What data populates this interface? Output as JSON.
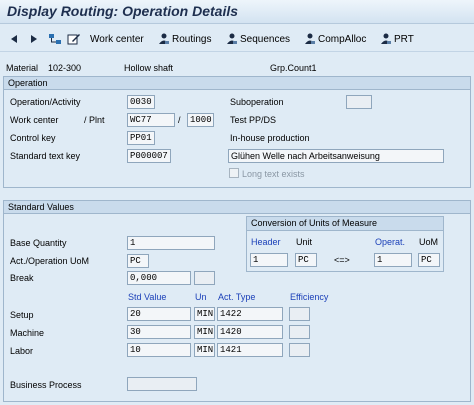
{
  "window": {
    "title": "Display Routing: Operation Details"
  },
  "toolbar": {
    "work_center": "Work center",
    "routings": "Routings",
    "sequences": "Sequences",
    "compalloc": "CompAlloc",
    "prt": "PRT"
  },
  "header": {
    "material_label": "Material",
    "material_value": "102-300",
    "material_desc": "Hollow shaft",
    "grp_count": "Grp.Count1"
  },
  "operation": {
    "group_title": "Operation",
    "op_activity_label": "Operation/Activity",
    "op_activity_value": "0030",
    "suboperation_label": "Suboperation",
    "suboperation_value": "",
    "work_center_label": "Work center",
    "plnt_label": "/ Plnt",
    "work_center_value": "WC77",
    "plant_value": "1000",
    "test_pp": "Test PP/DS",
    "control_key_label": "Control key",
    "control_key_value": "PP01",
    "inhouse": "In-house production",
    "std_text_label": "Standard text key",
    "std_text_value": "P000007",
    "std_text_desc": "Glühen Welle nach Arbeitsanweisung",
    "long_text": "Long text exists"
  },
  "standard_values": {
    "group_title": "Standard Values",
    "base_qty_label": "Base Quantity",
    "base_qty_value": "1",
    "act_uom_label": "Act./Operation UoM",
    "act_uom_value": "PC",
    "break_label": "Break",
    "break_value": "0,000",
    "break_unit": "",
    "col_std_value": "Std Value",
    "col_un": "Un",
    "col_act_type": "Act. Type",
    "col_efficiency": "Efficiency",
    "rows": [
      {
        "label": "Setup",
        "value": "20",
        "unit": "MIN",
        "act_type": "1422"
      },
      {
        "label": "Machine",
        "value": "30",
        "unit": "MIN",
        "act_type": "1420"
      },
      {
        "label": "Labor",
        "value": "10",
        "unit": "MIN",
        "act_type": "1421"
      }
    ],
    "business_process_label": "Business Process",
    "business_process_value": ""
  },
  "conversion": {
    "title": "Conversion of Units of Measure",
    "header_label": "Header",
    "unit_label": "Unit",
    "operat_label": "Operat.",
    "uom_label": "UoM",
    "header_value": "1",
    "header_unit": "PC",
    "arrow": "<=>",
    "operat_value": "1",
    "operat_unit": "PC"
  }
}
